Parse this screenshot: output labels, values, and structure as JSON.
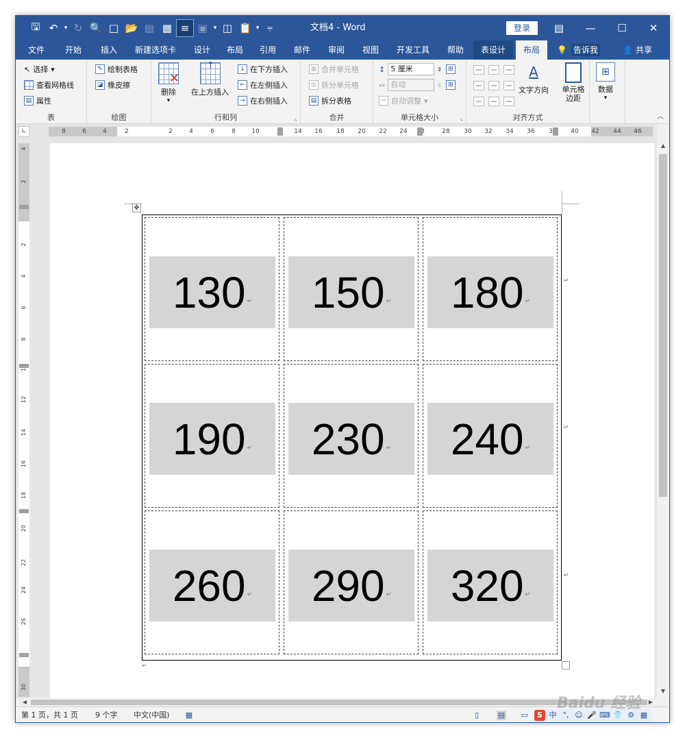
{
  "window": {
    "title": "文档4  -  Word",
    "login_label": "登录",
    "controls": {
      "ribbon_options": "ribbon-display-icon",
      "minimize": "—",
      "maximize": "☐",
      "close": "✕"
    }
  },
  "quick_access": [
    "save-icon",
    "undo-icon",
    "redo-icon",
    "print-preview-icon",
    "new-doc-icon",
    "open-icon",
    "clipboard-icon",
    "table-icon",
    "page-view-icon",
    "image-icon",
    "columns-icon",
    "paste-icon",
    "customize-icon"
  ],
  "tabs": [
    {
      "label": "文件"
    },
    {
      "label": "开始"
    },
    {
      "label": "插入"
    },
    {
      "label": "新建选项卡"
    },
    {
      "label": "设计"
    },
    {
      "label": "布局"
    },
    {
      "label": "引用"
    },
    {
      "label": "邮件"
    },
    {
      "label": "审阅"
    },
    {
      "label": "视图"
    },
    {
      "label": "开发工具"
    },
    {
      "label": "帮助"
    },
    {
      "label": "表设计"
    },
    {
      "label": "布局"
    }
  ],
  "tell_me": "告诉我",
  "share": "共享",
  "ribbon": {
    "table_group": {
      "label": "表",
      "select": "选择",
      "view_gridlines": "查看网格线",
      "properties": "属性"
    },
    "draw_group": {
      "label": "绘图",
      "draw_table": "绘制表格",
      "eraser": "橡皮擦"
    },
    "rows_cols_group": {
      "label": "行和列",
      "delete": "删除",
      "insert_above": "在上方插入",
      "insert_below": "在下方插入",
      "insert_left": "在左侧插入",
      "insert_right": "在右侧插入"
    },
    "merge_group": {
      "label": "合并",
      "merge_cells": "合并单元格",
      "split_cells": "拆分单元格",
      "split_table": "拆分表格"
    },
    "cell_size_group": {
      "label": "单元格大小",
      "height_value": "5 厘米",
      "width_value": "自动",
      "autofit": "自动调整"
    },
    "alignment_group": {
      "label": "对齐方式",
      "text_direction": "文字方向",
      "cell_margins": "单元格\n边距"
    },
    "data_group": {
      "label": "数据"
    }
  },
  "ruler": {
    "h_numbers": [
      "8",
      "6",
      "4",
      "2",
      "2",
      "4",
      "6",
      "8",
      "10",
      "14",
      "16",
      "18",
      "20",
      "22",
      "24",
      "3",
      "28",
      "30",
      "32",
      "34",
      "36",
      "38",
      "40",
      "42",
      "44",
      "46"
    ],
    "v_numbers": [
      "4",
      "2",
      "2",
      "4",
      "6",
      "8",
      "10",
      "12",
      "14",
      "16",
      "18",
      "20",
      "22",
      "24",
      "26",
      "30"
    ]
  },
  "table": {
    "rows": [
      [
        "130",
        "150",
        "180"
      ],
      [
        "190",
        "230",
        "240"
      ],
      [
        "260",
        "290",
        "320"
      ]
    ],
    "para_mark": "↵"
  },
  "status": {
    "page": "第 1 页，共 1 页",
    "words": "9 个字",
    "language": "中文(中国)"
  },
  "ime": [
    "S",
    "中",
    "°,",
    "☺",
    "🎤",
    "⌨",
    "👕",
    "⚙",
    "▦"
  ],
  "watermark": "Baidu 经验"
}
